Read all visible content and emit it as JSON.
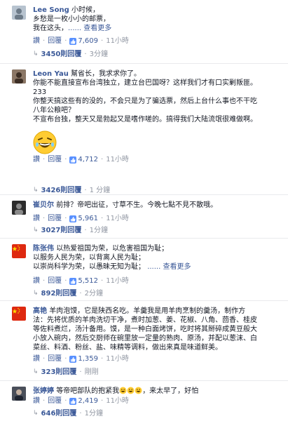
{
  "ui": {
    "sep": "·",
    "reply_label": "回覆",
    "reply_count_suffix": "則回覆"
  },
  "comments": [
    {
      "author": "Lee Song",
      "lines": [
        "小时候，",
        "乡愁是一枚小小的邮票，",
        "我在这头，"
      ],
      "see_more": "...... 查看更多",
      "action": "讚",
      "reply": "回覆",
      "likes": "7,609",
      "time": "11小時",
      "reply_count": "3450則回覆",
      "reply_time": "3分鐘",
      "avatar": "avatar-portrait"
    },
    {
      "author": "Leon Yau",
      "lines": [
        "幫省长，我求求你了。",
        "你能不能直接宣布台湾独立，建立台巴国呀？这样我们才有口实剿叛匪。",
        "233",
        "你整天搞这些有的没的，不会只是为了骗选票，然后上台什么事也不干吃",
        "八年公粮吧？",
        "不宣布台独，整天又是勃起又是嗜作嗟的。搞得我们大陆流氓很难做啊。"
      ],
      "action": "讚",
      "reply": "回覆",
      "likes": "4,712",
      "time": "11小時",
      "reply_count": "3426則回覆",
      "reply_time": "1 分鐘",
      "avatar": "avatar-portrait"
    },
    {
      "author": "崔贝尔",
      "lines": [
        "前排？帝吧出征，寸草不生。今晚七點不見不散哦。"
      ],
      "action": "讚",
      "reply": "回覆",
      "likes": "5,961",
      "time": "11小時",
      "reply_count": "3027則回覆",
      "reply_time": "1分鐘",
      "avatar": "avatar-portrait"
    },
    {
      "author": "陈张伟",
      "lines": [
        "以热爱祖国为荣，以危害祖国为耻；",
        "以服务人民为荣，以背离人民为耻；",
        "以崇尚科学为荣，以愚昧无知为耻；"
      ],
      "see_more": "...... 查看更多",
      "action": "讚",
      "reply": "回覆",
      "likes": "5,512",
      "time": "11小時",
      "reply_count": "892則回覆",
      "reply_time": "2分鐘",
      "avatar": "flag-cn"
    },
    {
      "author": "高艳",
      "lines": [
        "羊肉泡馍，它是陕西名吃。羊羹我是用羊肉烹制的羹汤，制作方",
        "法：先将优质的羊肉洗切干净，煮时加葱、姜、花椒、八角、茴香、桂皮",
        "等佐料煮烂，汤汁备用。馍，是一种白面烤饼，吃时将其掰碎成黄豆般大",
        "小放入碗内，然后交厨师在碗里放一定量的熟肉、原汤，并配以葱沫、白",
        "菜丝、料酒、粉丝、盐、味精等调料，做出来真是味道鲜美。"
      ],
      "action": "讚",
      "reply": "回覆",
      "likes": "1,359",
      "time": "11小時",
      "reply_count": "323則回覆",
      "reply_time": "剛剛",
      "avatar": "flag-cn"
    },
    {
      "author": "张婷婷",
      "line_before": "等帝吧部队的抱紧我",
      "line_after": "，来太早了，好怕",
      "action": "讚",
      "reply": "回覆",
      "likes": "2,419",
      "time": "11小時",
      "reply_count": "646則回覆",
      "reply_time": "1分鐘",
      "avatar": "avatar-portrait"
    }
  ],
  "colors": {
    "link": "#3b5998",
    "muted": "#9197a3",
    "like_badge": "#5890ff",
    "flag_red": "#de2910",
    "flag_star": "#ffde00",
    "emoji_yellow": "#ffcc33"
  }
}
